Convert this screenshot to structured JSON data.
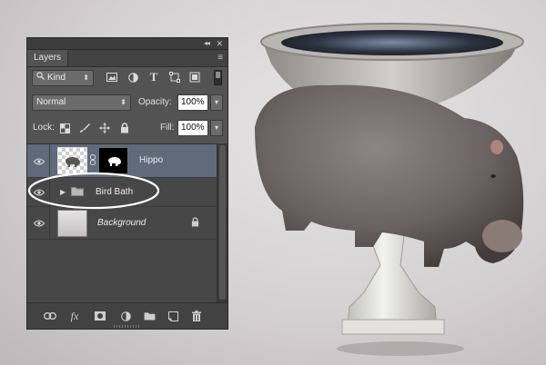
{
  "panel": {
    "tab_label": "Layers",
    "collapse_glyph": "◂◂",
    "close_glyph": "✕",
    "menu_glyph": "≡",
    "filter": {
      "kind_value": "Kind",
      "icons": [
        "image-filter-icon",
        "adjustment-filter-icon",
        "type-filter-icon",
        "shape-filter-icon",
        "smart-object-filter-icon"
      ]
    },
    "blend": {
      "mode_value": "Normal",
      "opacity_label": "Opacity:",
      "opacity_value": "100%"
    },
    "lock": {
      "label": "Lock:",
      "fill_label": "Fill:",
      "fill_value": "100%"
    },
    "layers": [
      {
        "name": "Hippo",
        "type": "layer-with-mask",
        "visible": true,
        "selected": true
      },
      {
        "name": "Bird Bath",
        "type": "group",
        "visible": true,
        "selected": false
      },
      {
        "name": "Background",
        "type": "background",
        "visible": true,
        "selected": false,
        "locked": true
      }
    ],
    "bottom_icons": [
      "link-layers-icon",
      "fx-icon",
      "add-mask-icon",
      "adjustment-layer-icon",
      "new-group-icon",
      "new-layer-icon",
      "trash-icon"
    ],
    "fx_label": "fx"
  },
  "colors": {
    "panel_bg": "#535353",
    "selected_layer": "#5f6a7a",
    "annotation": "#ffffff"
  }
}
